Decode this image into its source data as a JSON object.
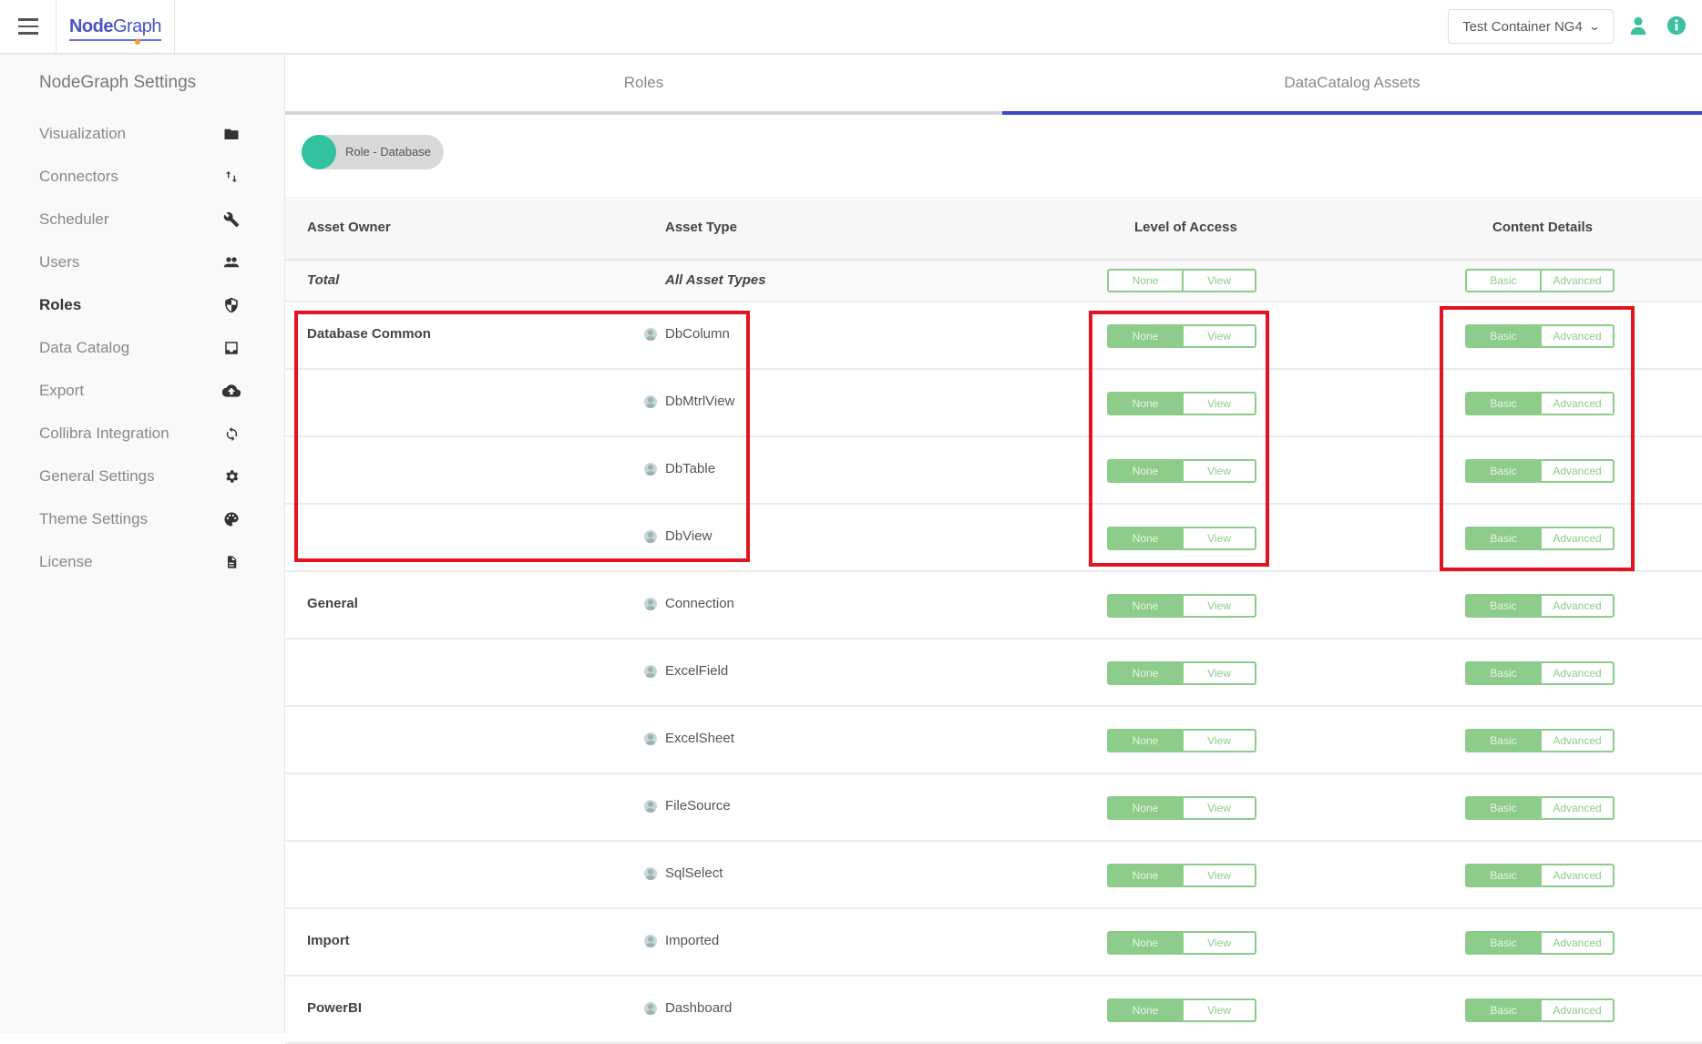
{
  "header": {
    "menu_icon": "hamburger-icon",
    "logo_bold": "Node",
    "logo_light": "Graph",
    "container_select": "Test Container NG4",
    "user_icon": "user-icon",
    "info_icon": "info-icon"
  },
  "sidebar": {
    "title": "NodeGraph Settings",
    "items": [
      {
        "label": "Visualization",
        "icon": "folder-icon"
      },
      {
        "label": "Connectors",
        "icon": "swap-vertical-icon"
      },
      {
        "label": "Scheduler",
        "icon": "wrench-icon"
      },
      {
        "label": "Users",
        "icon": "users-icon"
      },
      {
        "label": "Roles",
        "icon": "shield-icon",
        "active": true
      },
      {
        "label": "Data Catalog",
        "icon": "inbox-icon"
      },
      {
        "label": "Export",
        "icon": "cloud-upload-icon"
      },
      {
        "label": "Collibra Integration",
        "icon": "sync-icon"
      },
      {
        "label": "General Settings",
        "icon": "gear-icon"
      },
      {
        "label": "Theme Settings",
        "icon": "palette-icon"
      },
      {
        "label": "License",
        "icon": "file-icon"
      }
    ]
  },
  "tabs": [
    {
      "label": "Roles",
      "active": false
    },
    {
      "label": "DataCatalog Assets",
      "active": true
    }
  ],
  "role_toggle": {
    "label": "Role - Database",
    "on": true
  },
  "table": {
    "columns": [
      "Asset Owner",
      "Asset Type",
      "Level of Access",
      "Content Details"
    ],
    "level_options": [
      "None",
      "View"
    ],
    "content_options": [
      "Basic",
      "Advanced"
    ],
    "total": {
      "owner": "Total",
      "type": "All Asset Types",
      "level": null,
      "content": null
    },
    "rows": [
      {
        "owner": "Database Common",
        "type": "DbColumn",
        "level": "None",
        "content": "Basic"
      },
      {
        "owner": "",
        "type": "DbMtrlView",
        "level": "None",
        "content": "Basic"
      },
      {
        "owner": "",
        "type": "DbTable",
        "level": "None",
        "content": "Basic"
      },
      {
        "owner": "",
        "type": "DbView",
        "level": "None",
        "content": "Basic"
      },
      {
        "owner": "General",
        "type": "Connection",
        "level": "None",
        "content": "Basic"
      },
      {
        "owner": "",
        "type": "ExcelField",
        "level": "None",
        "content": "Basic"
      },
      {
        "owner": "",
        "type": "ExcelSheet",
        "level": "None",
        "content": "Basic"
      },
      {
        "owner": "",
        "type": "FileSource",
        "level": "None",
        "content": "Basic"
      },
      {
        "owner": "",
        "type": "SqlSelect",
        "level": "None",
        "content": "Basic"
      },
      {
        "owner": "Import",
        "type": "Imported",
        "level": "None",
        "content": "Basic"
      },
      {
        "owner": "PowerBI",
        "type": "Dashboard",
        "level": "None",
        "content": "Basic"
      }
    ]
  },
  "colors": {
    "accent_blue": "#3c48c4",
    "teal": "#33c2a0",
    "toggle_green": "#8dcc8b",
    "highlight_red": "#e3141f"
  }
}
